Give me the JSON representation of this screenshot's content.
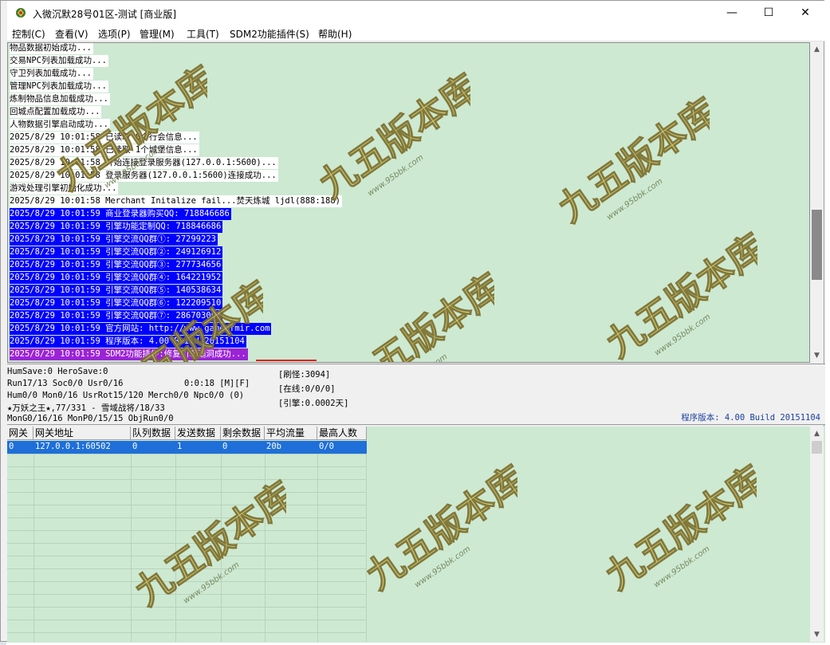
{
  "window": {
    "title": "入微沉默28号01区-测试 [商业版]",
    "minimize": "—",
    "maximize": "☐",
    "close": "✕"
  },
  "menu": [
    {
      "label": "控制(C)"
    },
    {
      "label": "查看(V)"
    },
    {
      "label": "选项(P)"
    },
    {
      "label": "管理(M)"
    },
    {
      "label": "工具(T)"
    },
    {
      "label": "SDM2功能插件(S)"
    },
    {
      "label": "帮助(H)"
    }
  ],
  "log": [
    {
      "text": "物品数据初始成功...",
      "style": "plain"
    },
    {
      "text": "交易NPC列表加载成功...",
      "style": "plain"
    },
    {
      "text": "守卫列表加载成功...",
      "style": "plain"
    },
    {
      "text": "管理NPC列表加载成功...",
      "style": "plain"
    },
    {
      "text": "炼制物品信息加载成功...",
      "style": "plain"
    },
    {
      "text": "回城点配置加载成功...",
      "style": "plain"
    },
    {
      "text": "人物数据引擎启动成功...",
      "style": "plain"
    },
    {
      "text": "2025/8/29 10:01:58 已读取 0个行会信息...",
      "style": "plain"
    },
    {
      "text": "2025/8/29 10:01:58 已读取 1个城堡信息...",
      "style": "plain"
    },
    {
      "text": "2025/8/29 10:01:58 开始连接登录服务器(127.0.0.1:5600)...",
      "style": "plain"
    },
    {
      "text": "2025/8/29 10:01:58 登录服务器(127.0.0.1:5600)连接成功...",
      "style": "plain"
    },
    {
      "text": "游戏处理引擎初始化成功...",
      "style": "plain"
    },
    {
      "text": "2025/8/29 10:01:58 Merchant Initalize fail...焚天炼城 ljdl(888:188)",
      "style": "plain"
    },
    {
      "text": "2025/8/29 10:01:59 商业登录器购买QQ: 718846686",
      "style": "blue"
    },
    {
      "text": "2025/8/29 10:01:59 引擎功能定制QQ: 718846686",
      "style": "blue"
    },
    {
      "text": "2025/8/29 10:01:59 引擎交流QQ群①: 27299223",
      "style": "blue"
    },
    {
      "text": "2025/8/29 10:01:59 引擎交流QQ群②: 249126912",
      "style": "blue"
    },
    {
      "text": "2025/8/29 10:01:59 引擎交流QQ群③: 277734656",
      "style": "blue"
    },
    {
      "text": "2025/8/29 10:01:59 引擎交流QQ群④: 164221952",
      "style": "blue"
    },
    {
      "text": "2025/8/29 10:01:59 引擎交流QQ群⑤: 140538634",
      "style": "blue"
    },
    {
      "text": "2025/8/29 10:01:59 引擎交流QQ群⑥: 122209510",
      "style": "blue"
    },
    {
      "text": "2025/8/29 10:01:59 引擎交流QQ群⑦: 286703001",
      "style": "blue"
    },
    {
      "text": "2025/8/29 10:01:59 官方网站: http://www.gameofmir.com",
      "style": "blue"
    },
    {
      "text": "2025/8/29 10:01:59 程序版本: 4.00 Build 20151104",
      "style": "blue"
    },
    {
      "text": "2025/8/29 10:01:59 SDM2功能插件:修复引擎漏洞成功...",
      "style": "purple"
    }
  ],
  "status": {
    "line1": "HumSave:0 HeroSave:0",
    "line2": "Run17/13 Soc0/0 Usr0/16",
    "line2_time": "0:0:18 [M][F]",
    "line3": "Hum0/0 Mon0/16 UsrRot15/120 Merch0/0 Npc0/0 (0)",
    "line4": "★万妖之王★,77/331 - 雪域战将/18/33",
    "line5": "MonG0/16/16 MonP0/15/15 ObjRun0/0",
    "refresh": "[刷怪:3094]",
    "online": "[在线:0/0/0]",
    "engine": "[引擎:0.0002天]",
    "version": "程序版本: 4.00 Build 20151104"
  },
  "grid": {
    "headers": [
      "网关",
      "网关地址",
      "队列数据",
      "发送数据",
      "剩余数据",
      "平均流量",
      "最高人数"
    ],
    "rows": [
      [
        "0",
        "127.0.0.1:60502",
        "0",
        "1",
        "0",
        "20b",
        "0/0"
      ]
    ]
  },
  "watermark": {
    "text": "九五版本库",
    "url": "www.95bbk.com"
  },
  "colors": {
    "log_bg": "#cde9d2",
    "highlight_blue": "#0000ff",
    "highlight_purple": "#9b23d6",
    "selection": "#1e6fd9"
  }
}
